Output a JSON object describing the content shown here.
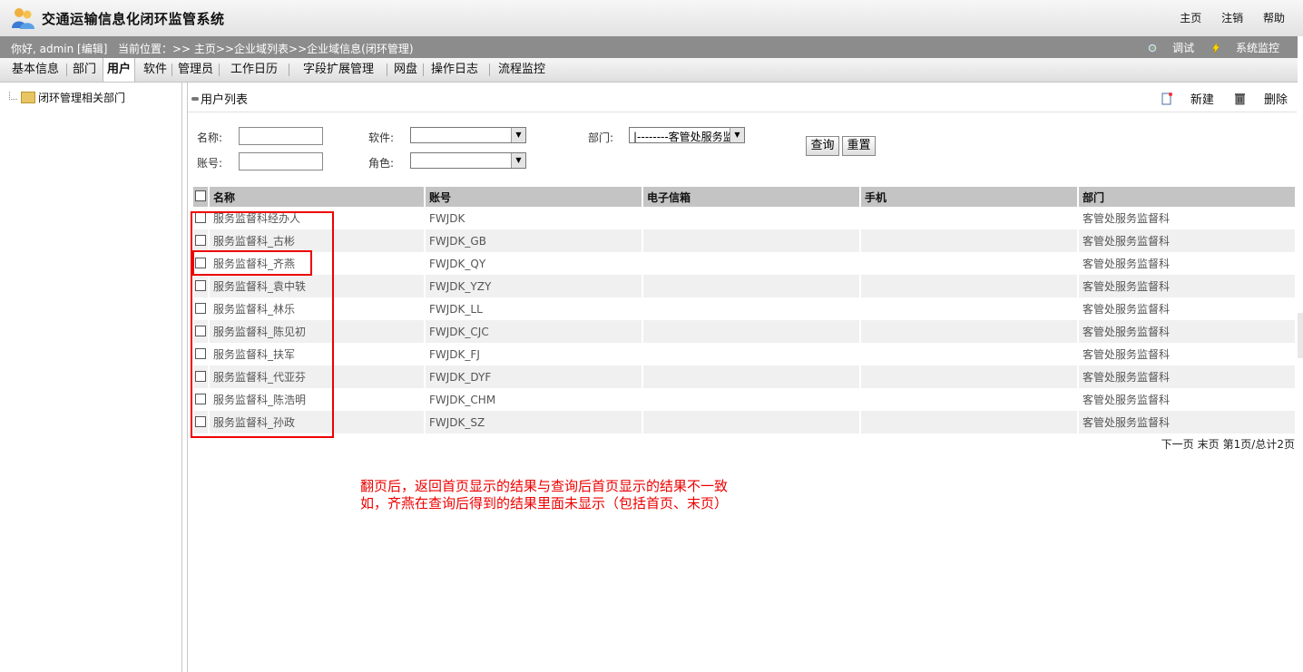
{
  "header": {
    "title": "交通运输信息化闭环监管系统",
    "links": [
      "主页",
      "注销",
      "帮助"
    ]
  },
  "infobar": {
    "greeting": "你好, admin [编辑]",
    "breadcrumb": "当前位置：>> 主页>>企业域列表>>企业域信息(闭环管理)",
    "debug": "调试",
    "monitor": "系统监控"
  },
  "tabs": [
    "基本信息",
    "部门",
    "用户",
    "软件",
    "管理员",
    "工作日历",
    "字段扩展管理",
    "网盘",
    "操作日志",
    "流程监控"
  ],
  "active_tab": "用户",
  "sidebar": {
    "tree_root": "闭环管理相关部门"
  },
  "list": {
    "title": "用户列表",
    "new_label": "新建",
    "delete_label": "删除"
  },
  "filters": {
    "name_label": "名称:",
    "account_label": "账号:",
    "software_label": "软件:",
    "role_label": "角色:",
    "dept_label": "部门:",
    "dept_value": "|--------客管处服务监",
    "query_label": "查询",
    "reset_label": "重置"
  },
  "table": {
    "columns": [
      "名称",
      "账号",
      "电子信箱",
      "手机",
      "部门"
    ],
    "rows": [
      {
        "name": "服务监督科经办人",
        "account": "FWJDK",
        "email": "",
        "phone": "",
        "dept": "客管处服务监督科"
      },
      {
        "name": "服务监督科_古彬",
        "account": "FWJDK_GB",
        "email": "",
        "phone": "",
        "dept": "客管处服务监督科"
      },
      {
        "name": "服务监督科_齐燕",
        "account": "FWJDK_QY",
        "email": "",
        "phone": "",
        "dept": "客管处服务监督科"
      },
      {
        "name": "服务监督科_袁中轶",
        "account": "FWJDK_YZY",
        "email": "",
        "phone": "",
        "dept": "客管处服务监督科"
      },
      {
        "name": "服务监督科_林乐",
        "account": "FWJDK_LL",
        "email": "",
        "phone": "",
        "dept": "客管处服务监督科"
      },
      {
        "name": "服务监督科_陈见初",
        "account": "FWJDK_CJC",
        "email": "",
        "phone": "",
        "dept": "客管处服务监督科"
      },
      {
        "name": "服务监督科_扶军",
        "account": "FWJDK_FJ",
        "email": "",
        "phone": "",
        "dept": "客管处服务监督科"
      },
      {
        "name": "服务监督科_代亚芬",
        "account": "FWJDK_DYF",
        "email": "",
        "phone": "",
        "dept": "客管处服务监督科"
      },
      {
        "name": "服务监督科_陈浩明",
        "account": "FWJDK_CHM",
        "email": "",
        "phone": "",
        "dept": "客管处服务监督科"
      },
      {
        "name": "服务监督科_孙政",
        "account": "FWJDK_SZ",
        "email": "",
        "phone": "",
        "dept": "客管处服务监督科"
      }
    ]
  },
  "pager": {
    "next": "下一页",
    "last": "末页",
    "status": "第1页/总计2页"
  },
  "annotation": {
    "line1": "翻页后，返回首页显示的结果与查询后首页显示的结果不一致",
    "line2": "如，齐燕在查询后得到的结果里面未显示（包括首页、末页）"
  },
  "colors": {
    "annotation_red": "#ee0000",
    "infobar_gray": "#8c8c8c",
    "header_gray": "#c4c4c4"
  }
}
